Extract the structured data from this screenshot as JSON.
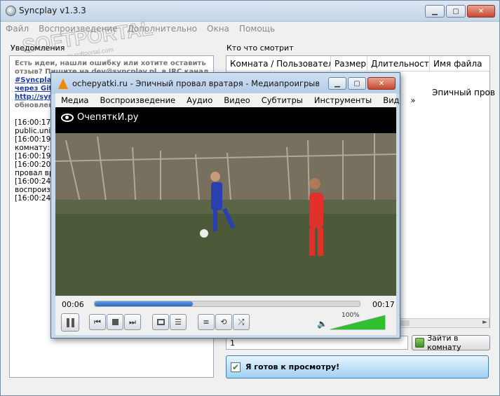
{
  "app": {
    "title": "Syncplay v1.3.3"
  },
  "menu": [
    "Файл",
    "Воспроизведение",
    "Дополнительно",
    "Окна",
    "Помощь"
  ],
  "left": {
    "label": "Уведомления",
    "lines": [
      {
        "text": "Есть идеи, нашли ошибку или хотите оставить",
        "style": "gray"
      },
      {
        "text": "отзыв? Пишите на dev@syncplay.pl, в IRC канал",
        "style": "gray"
      },
      {
        "text": "#Syncplay",
        "style": "link"
      },
      {
        "text": "через Git",
        "style": "link"
      },
      {
        "text": "http://syn",
        "style": "link"
      },
      {
        "text": "обновлен",
        "style": "gray"
      },
      {
        "text": "[16:00:17]",
        "style": "plain"
      },
      {
        "text": "public.unity",
        "style": "plain"
      },
      {
        "text": "[16:00:19]",
        "style": "plain"
      },
      {
        "text": "комнату: '",
        "style": "plain"
      },
      {
        "text": "[16:00:19]",
        "style": "plain"
      },
      {
        "text": "[16:00:20]",
        "style": "plain"
      },
      {
        "text": "провал вр",
        "style": "plain"
      },
      {
        "text": "[16:00:24]",
        "style": "plain"
      },
      {
        "text": "воспроизв",
        "style": "plain"
      },
      {
        "text": "[16:00:24]",
        "style": "plain"
      }
    ]
  },
  "right": {
    "label": "Кто что смотрит",
    "columns": [
      "Комната / Пользователь",
      "Размер",
      "Длительность",
      "Имя файла"
    ],
    "row_filename": "Эпичный пров"
  },
  "room": {
    "value": "1",
    "join_label": "Зайти в комнату"
  },
  "ready": {
    "label": "Я готов к просмотру!",
    "checked": true
  },
  "watermark": {
    "text": "SOFTPORTAL",
    "sub": "www.softportal.com"
  },
  "vlc": {
    "title": "ochepyatki.ru - Эпичный провал вратаря - Медиапроигрывател...",
    "menu": [
      "Медиа",
      "Воспроизведение",
      "Аудио",
      "Видео",
      "Субтитры",
      "Инструменты",
      "Вид",
      "»"
    ],
    "video_logo": "ОчепяткИ.ру",
    "time_elapsed": "00:06",
    "time_total": "00:17",
    "progress": 0.37,
    "volume_label": "100%",
    "volume": 1.0
  },
  "colors": {
    "accent": "#2a69b8",
    "volume": "#2fbf2f",
    "ready_bg": "#9fd0f2"
  }
}
